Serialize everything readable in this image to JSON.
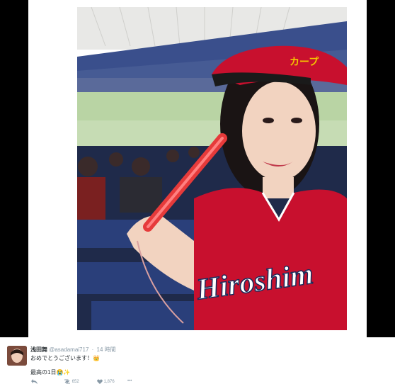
{
  "tweet": {
    "display_name": "浅田舞",
    "handle": "@asadamai717",
    "separator": "·",
    "time": "14 時間",
    "line1_text": "おめでとうございます！",
    "line1_emoji": "👑",
    "line2_text": "最高の1日",
    "line2_emojis": "😭✨",
    "retweet_count": "652",
    "like_count": "1,876",
    "more": "•••"
  },
  "photo": {
    "jersey_text": "Hiroshim",
    "cap_text": "カープ",
    "colors": {
      "jersey_red": "#c8102e",
      "stand_blue": "#2a3f7a",
      "field_green": "#8fb37a"
    }
  },
  "colors": {
    "frame": "#000000",
    "text": "#292f33",
    "muted": "#8899a6"
  }
}
